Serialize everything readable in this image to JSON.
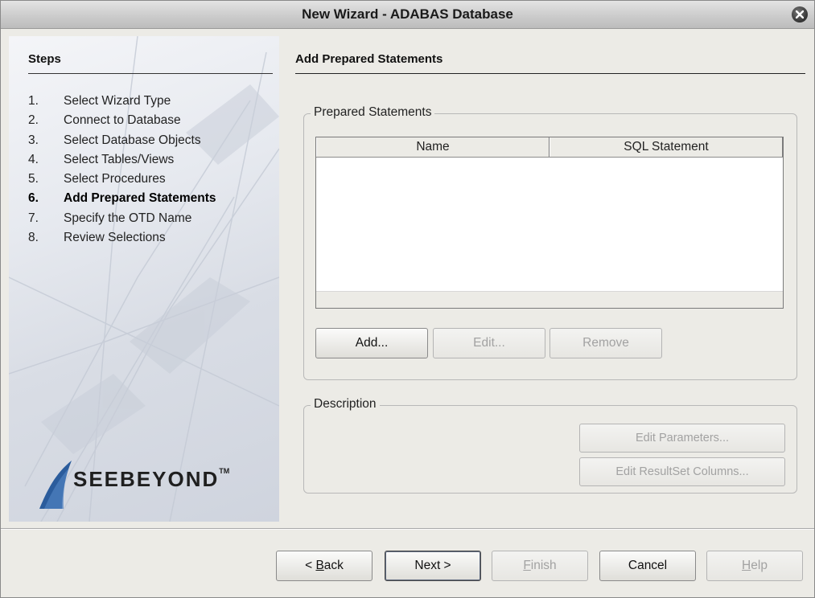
{
  "window": {
    "title": "New Wizard - ADABAS Database"
  },
  "steps": {
    "title": "Steps",
    "items": [
      {
        "num": "1.",
        "label": "Select Wizard Type"
      },
      {
        "num": "2.",
        "label": "Connect to Database"
      },
      {
        "num": "3.",
        "label": "Select Database Objects"
      },
      {
        "num": "4.",
        "label": "Select Tables/Views"
      },
      {
        "num": "5.",
        "label": "Select Procedures"
      },
      {
        "num": "6.",
        "label": "Add Prepared Statements",
        "active": true
      },
      {
        "num": "7.",
        "label": "Specify the OTD Name"
      },
      {
        "num": "8.",
        "label": "Review Selections"
      }
    ]
  },
  "logo": {
    "text": "SEEBEYOND",
    "tm": "TM"
  },
  "page": {
    "title": "Add Prepared Statements"
  },
  "prepared": {
    "legend": "Prepared Statements",
    "columns": [
      "Name",
      "SQL Statement"
    ],
    "add_label": "Add...",
    "edit_label": "Edit...",
    "remove_label": "Remove"
  },
  "description": {
    "legend": "Description",
    "edit_params_label": "Edit Parameters...",
    "edit_resultset_label": "Edit ResultSet Columns..."
  },
  "footer": {
    "back": {
      "prefix": "< ",
      "mnemonic": "B",
      "rest": "ack"
    },
    "next_label": "Next >",
    "finish": {
      "mnemonic": "F",
      "rest": "inish"
    },
    "cancel_label": "Cancel",
    "help": {
      "mnemonic": "H",
      "rest": "elp"
    }
  },
  "colors": {
    "accent": "#3a6ea5",
    "logo_blue": "#2b5c9c"
  }
}
